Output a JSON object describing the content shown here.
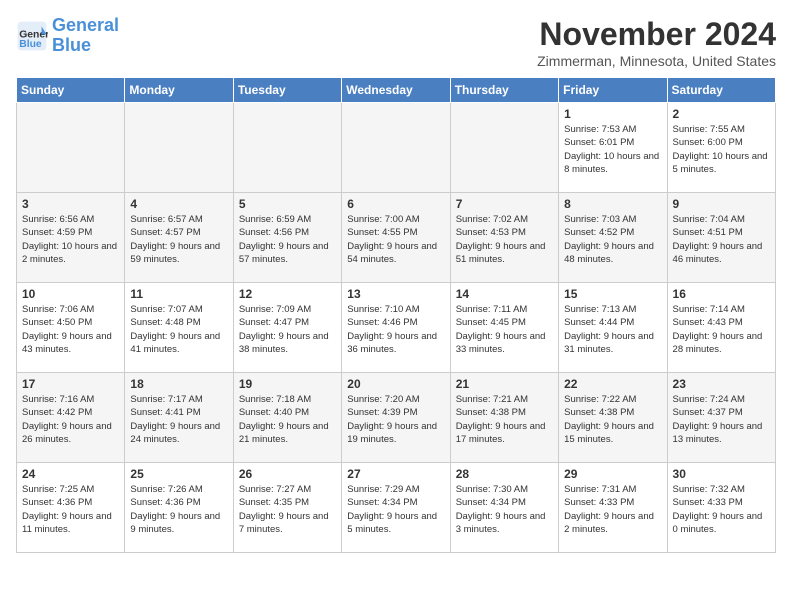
{
  "header": {
    "logo_line1": "General",
    "logo_line2": "Blue",
    "month_title": "November 2024",
    "location": "Zimmerman, Minnesota, United States"
  },
  "days_of_week": [
    "Sunday",
    "Monday",
    "Tuesday",
    "Wednesday",
    "Thursday",
    "Friday",
    "Saturday"
  ],
  "weeks": [
    [
      {
        "day": "",
        "info": "",
        "empty": true
      },
      {
        "day": "",
        "info": "",
        "empty": true
      },
      {
        "day": "",
        "info": "",
        "empty": true
      },
      {
        "day": "",
        "info": "",
        "empty": true
      },
      {
        "day": "",
        "info": "",
        "empty": true
      },
      {
        "day": "1",
        "info": "Sunrise: 7:53 AM\nSunset: 6:01 PM\nDaylight: 10 hours and 8 minutes.",
        "empty": false
      },
      {
        "day": "2",
        "info": "Sunrise: 7:55 AM\nSunset: 6:00 PM\nDaylight: 10 hours and 5 minutes.",
        "empty": false
      }
    ],
    [
      {
        "day": "3",
        "info": "Sunrise: 6:56 AM\nSunset: 4:59 PM\nDaylight: 10 hours and 2 minutes.",
        "empty": false
      },
      {
        "day": "4",
        "info": "Sunrise: 6:57 AM\nSunset: 4:57 PM\nDaylight: 9 hours and 59 minutes.",
        "empty": false
      },
      {
        "day": "5",
        "info": "Sunrise: 6:59 AM\nSunset: 4:56 PM\nDaylight: 9 hours and 57 minutes.",
        "empty": false
      },
      {
        "day": "6",
        "info": "Sunrise: 7:00 AM\nSunset: 4:55 PM\nDaylight: 9 hours and 54 minutes.",
        "empty": false
      },
      {
        "day": "7",
        "info": "Sunrise: 7:02 AM\nSunset: 4:53 PM\nDaylight: 9 hours and 51 minutes.",
        "empty": false
      },
      {
        "day": "8",
        "info": "Sunrise: 7:03 AM\nSunset: 4:52 PM\nDaylight: 9 hours and 48 minutes.",
        "empty": false
      },
      {
        "day": "9",
        "info": "Sunrise: 7:04 AM\nSunset: 4:51 PM\nDaylight: 9 hours and 46 minutes.",
        "empty": false
      }
    ],
    [
      {
        "day": "10",
        "info": "Sunrise: 7:06 AM\nSunset: 4:50 PM\nDaylight: 9 hours and 43 minutes.",
        "empty": false
      },
      {
        "day": "11",
        "info": "Sunrise: 7:07 AM\nSunset: 4:48 PM\nDaylight: 9 hours and 41 minutes.",
        "empty": false
      },
      {
        "day": "12",
        "info": "Sunrise: 7:09 AM\nSunset: 4:47 PM\nDaylight: 9 hours and 38 minutes.",
        "empty": false
      },
      {
        "day": "13",
        "info": "Sunrise: 7:10 AM\nSunset: 4:46 PM\nDaylight: 9 hours and 36 minutes.",
        "empty": false
      },
      {
        "day": "14",
        "info": "Sunrise: 7:11 AM\nSunset: 4:45 PM\nDaylight: 9 hours and 33 minutes.",
        "empty": false
      },
      {
        "day": "15",
        "info": "Sunrise: 7:13 AM\nSunset: 4:44 PM\nDaylight: 9 hours and 31 minutes.",
        "empty": false
      },
      {
        "day": "16",
        "info": "Sunrise: 7:14 AM\nSunset: 4:43 PM\nDaylight: 9 hours and 28 minutes.",
        "empty": false
      }
    ],
    [
      {
        "day": "17",
        "info": "Sunrise: 7:16 AM\nSunset: 4:42 PM\nDaylight: 9 hours and 26 minutes.",
        "empty": false
      },
      {
        "day": "18",
        "info": "Sunrise: 7:17 AM\nSunset: 4:41 PM\nDaylight: 9 hours and 24 minutes.",
        "empty": false
      },
      {
        "day": "19",
        "info": "Sunrise: 7:18 AM\nSunset: 4:40 PM\nDaylight: 9 hours and 21 minutes.",
        "empty": false
      },
      {
        "day": "20",
        "info": "Sunrise: 7:20 AM\nSunset: 4:39 PM\nDaylight: 9 hours and 19 minutes.",
        "empty": false
      },
      {
        "day": "21",
        "info": "Sunrise: 7:21 AM\nSunset: 4:38 PM\nDaylight: 9 hours and 17 minutes.",
        "empty": false
      },
      {
        "day": "22",
        "info": "Sunrise: 7:22 AM\nSunset: 4:38 PM\nDaylight: 9 hours and 15 minutes.",
        "empty": false
      },
      {
        "day": "23",
        "info": "Sunrise: 7:24 AM\nSunset: 4:37 PM\nDaylight: 9 hours and 13 minutes.",
        "empty": false
      }
    ],
    [
      {
        "day": "24",
        "info": "Sunrise: 7:25 AM\nSunset: 4:36 PM\nDaylight: 9 hours and 11 minutes.",
        "empty": false
      },
      {
        "day": "25",
        "info": "Sunrise: 7:26 AM\nSunset: 4:36 PM\nDaylight: 9 hours and 9 minutes.",
        "empty": false
      },
      {
        "day": "26",
        "info": "Sunrise: 7:27 AM\nSunset: 4:35 PM\nDaylight: 9 hours and 7 minutes.",
        "empty": false
      },
      {
        "day": "27",
        "info": "Sunrise: 7:29 AM\nSunset: 4:34 PM\nDaylight: 9 hours and 5 minutes.",
        "empty": false
      },
      {
        "day": "28",
        "info": "Sunrise: 7:30 AM\nSunset: 4:34 PM\nDaylight: 9 hours and 3 minutes.",
        "empty": false
      },
      {
        "day": "29",
        "info": "Sunrise: 7:31 AM\nSunset: 4:33 PM\nDaylight: 9 hours and 2 minutes.",
        "empty": false
      },
      {
        "day": "30",
        "info": "Sunrise: 7:32 AM\nSunset: 4:33 PM\nDaylight: 9 hours and 0 minutes.",
        "empty": false
      }
    ]
  ]
}
